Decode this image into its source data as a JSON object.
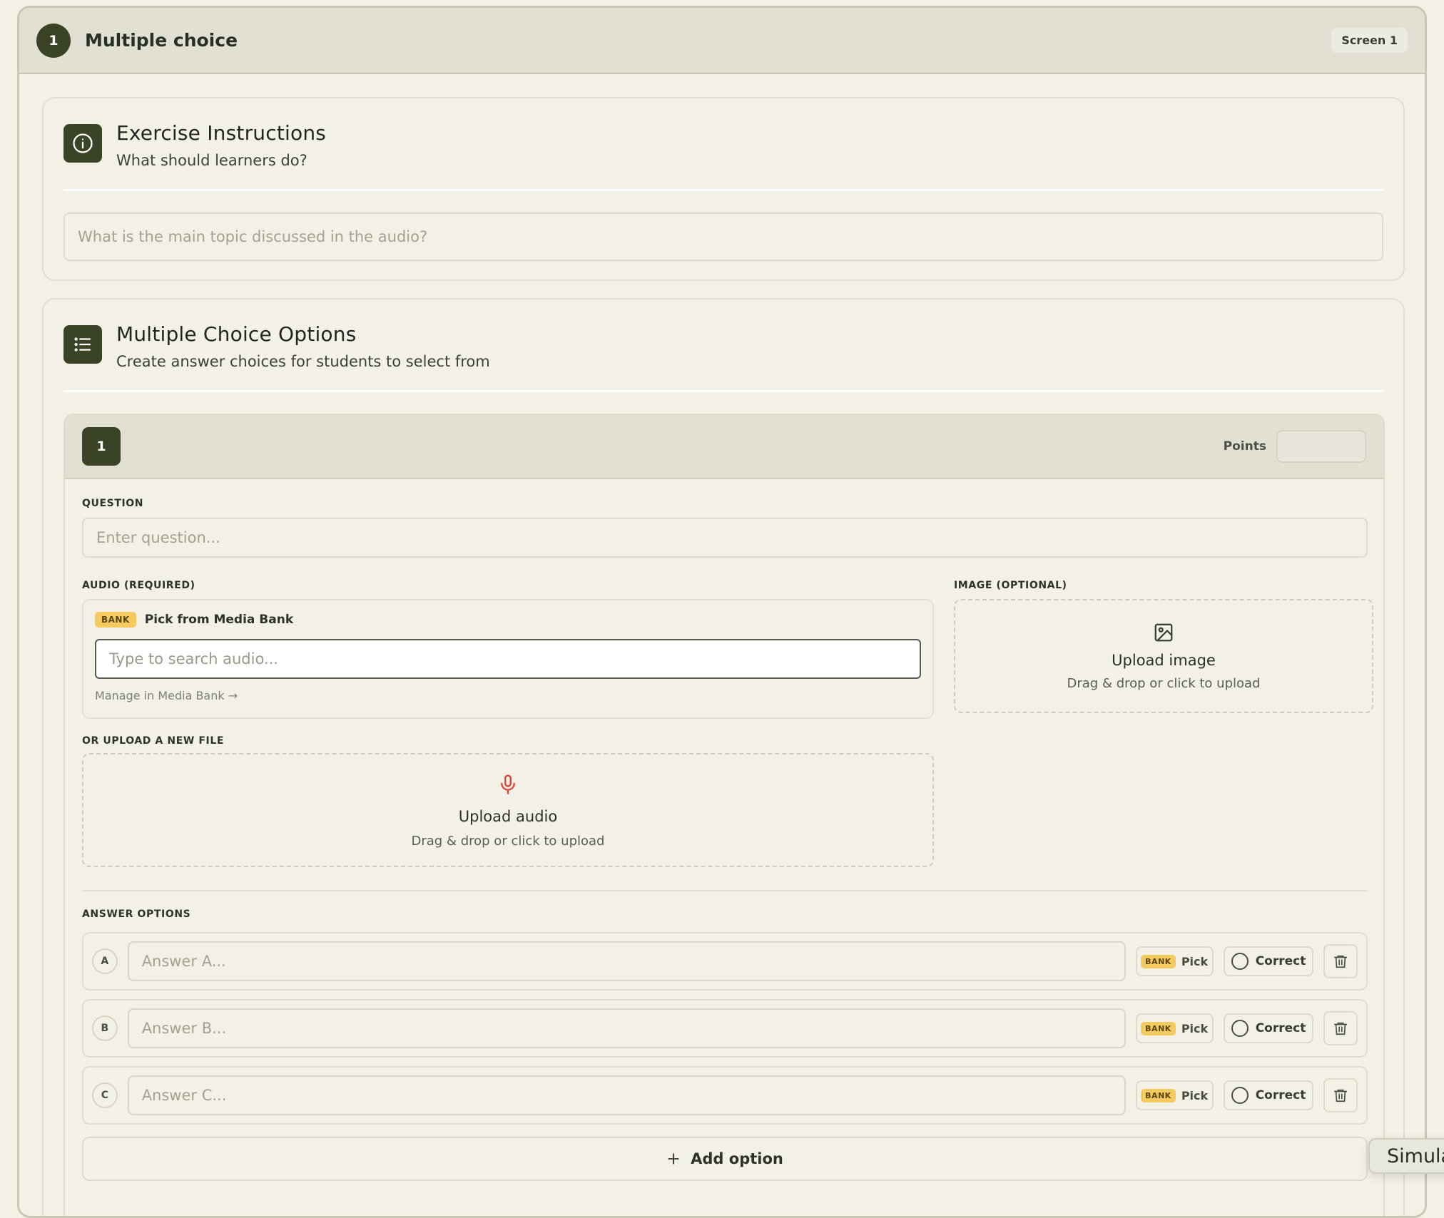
{
  "header": {
    "step_number": "1",
    "title": "Multiple choice",
    "screen_badge": "Screen 1"
  },
  "instructions": {
    "title": "Exercise Instructions",
    "subtitle": "What should learners do?",
    "input_placeholder": "What is the main topic discussed in the audio?",
    "icon": "info-icon"
  },
  "options_section": {
    "title": "Multiple Choice Options",
    "subtitle": "Create answer choices for students to select from",
    "icon": "list-icon"
  },
  "question_card": {
    "number": "1",
    "points_label": "Points",
    "points_value": "",
    "question_label": "QUESTION",
    "question_placeholder": "Enter question...",
    "audio_label": "AUDIO (REQUIRED)",
    "bank_tag": "BANK",
    "pick_from_bank": "Pick from Media Bank",
    "audio_search_placeholder": "Type to search audio...",
    "manage_link": "Manage in Media Bank →",
    "image_label": "IMAGE (OPTIONAL)",
    "upload_image_title": "Upload image",
    "upload_image_sub": "Drag & drop or click to upload",
    "or_upload_label": "OR UPLOAD A NEW FILE",
    "upload_audio_title": "Upload audio",
    "upload_audio_sub": "Drag & drop or click to upload",
    "answer_options_label": "ANSWER OPTIONS",
    "answers": [
      {
        "letter": "A",
        "placeholder": "Answer A...",
        "bank": "BANK",
        "pick": "Pick",
        "correct": "Correct"
      },
      {
        "letter": "B",
        "placeholder": "Answer B...",
        "bank": "BANK",
        "pick": "Pick",
        "correct": "Correct"
      },
      {
        "letter": "C",
        "placeholder": "Answer C...",
        "bank": "BANK",
        "pick": "Pick",
        "correct": "Correct"
      }
    ],
    "add_option": "Add option"
  },
  "floating_tab": {
    "label": "Simula"
  },
  "colors": {
    "accent": "#3a4325",
    "background": "#f3f1e5",
    "bank_tag": "#f4c95d",
    "mic_red": "#e0453f"
  }
}
